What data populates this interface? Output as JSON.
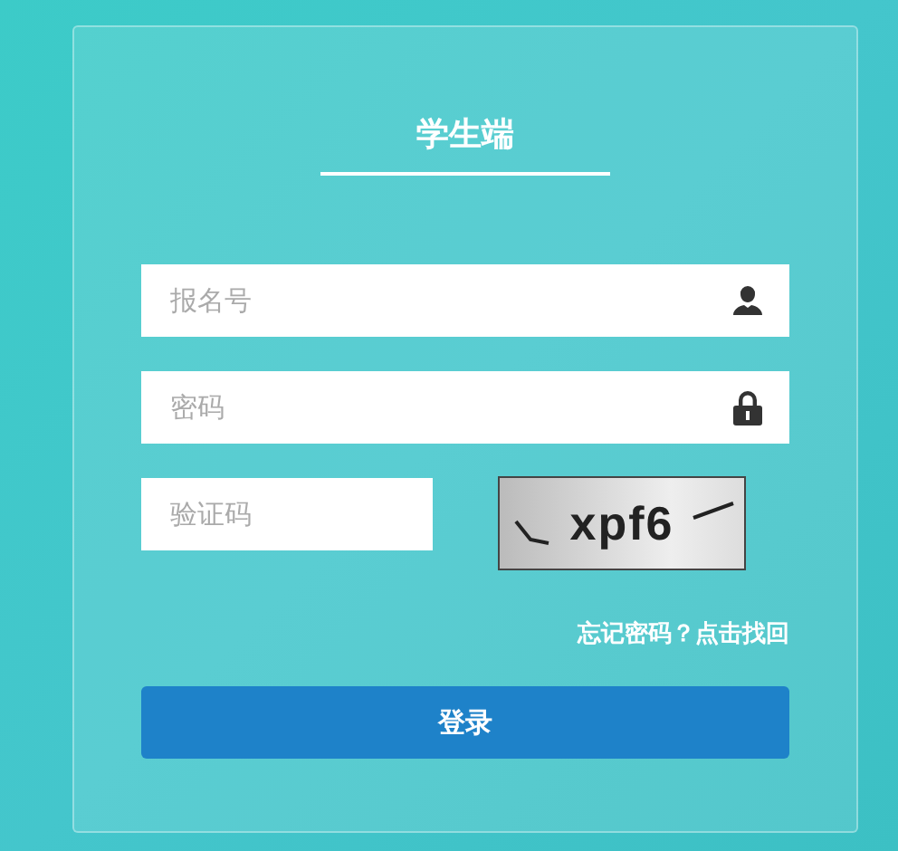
{
  "title": "学生端",
  "fields": [
    {
      "placeholder": "报名号",
      "kind": "user"
    },
    {
      "placeholder": "密码",
      "kind": "lock"
    }
  ],
  "captcha": {
    "placeholder": "验证码",
    "text": "xpf6"
  },
  "forgot_link": "忘记密码？点击找回",
  "login_button": "登录"
}
